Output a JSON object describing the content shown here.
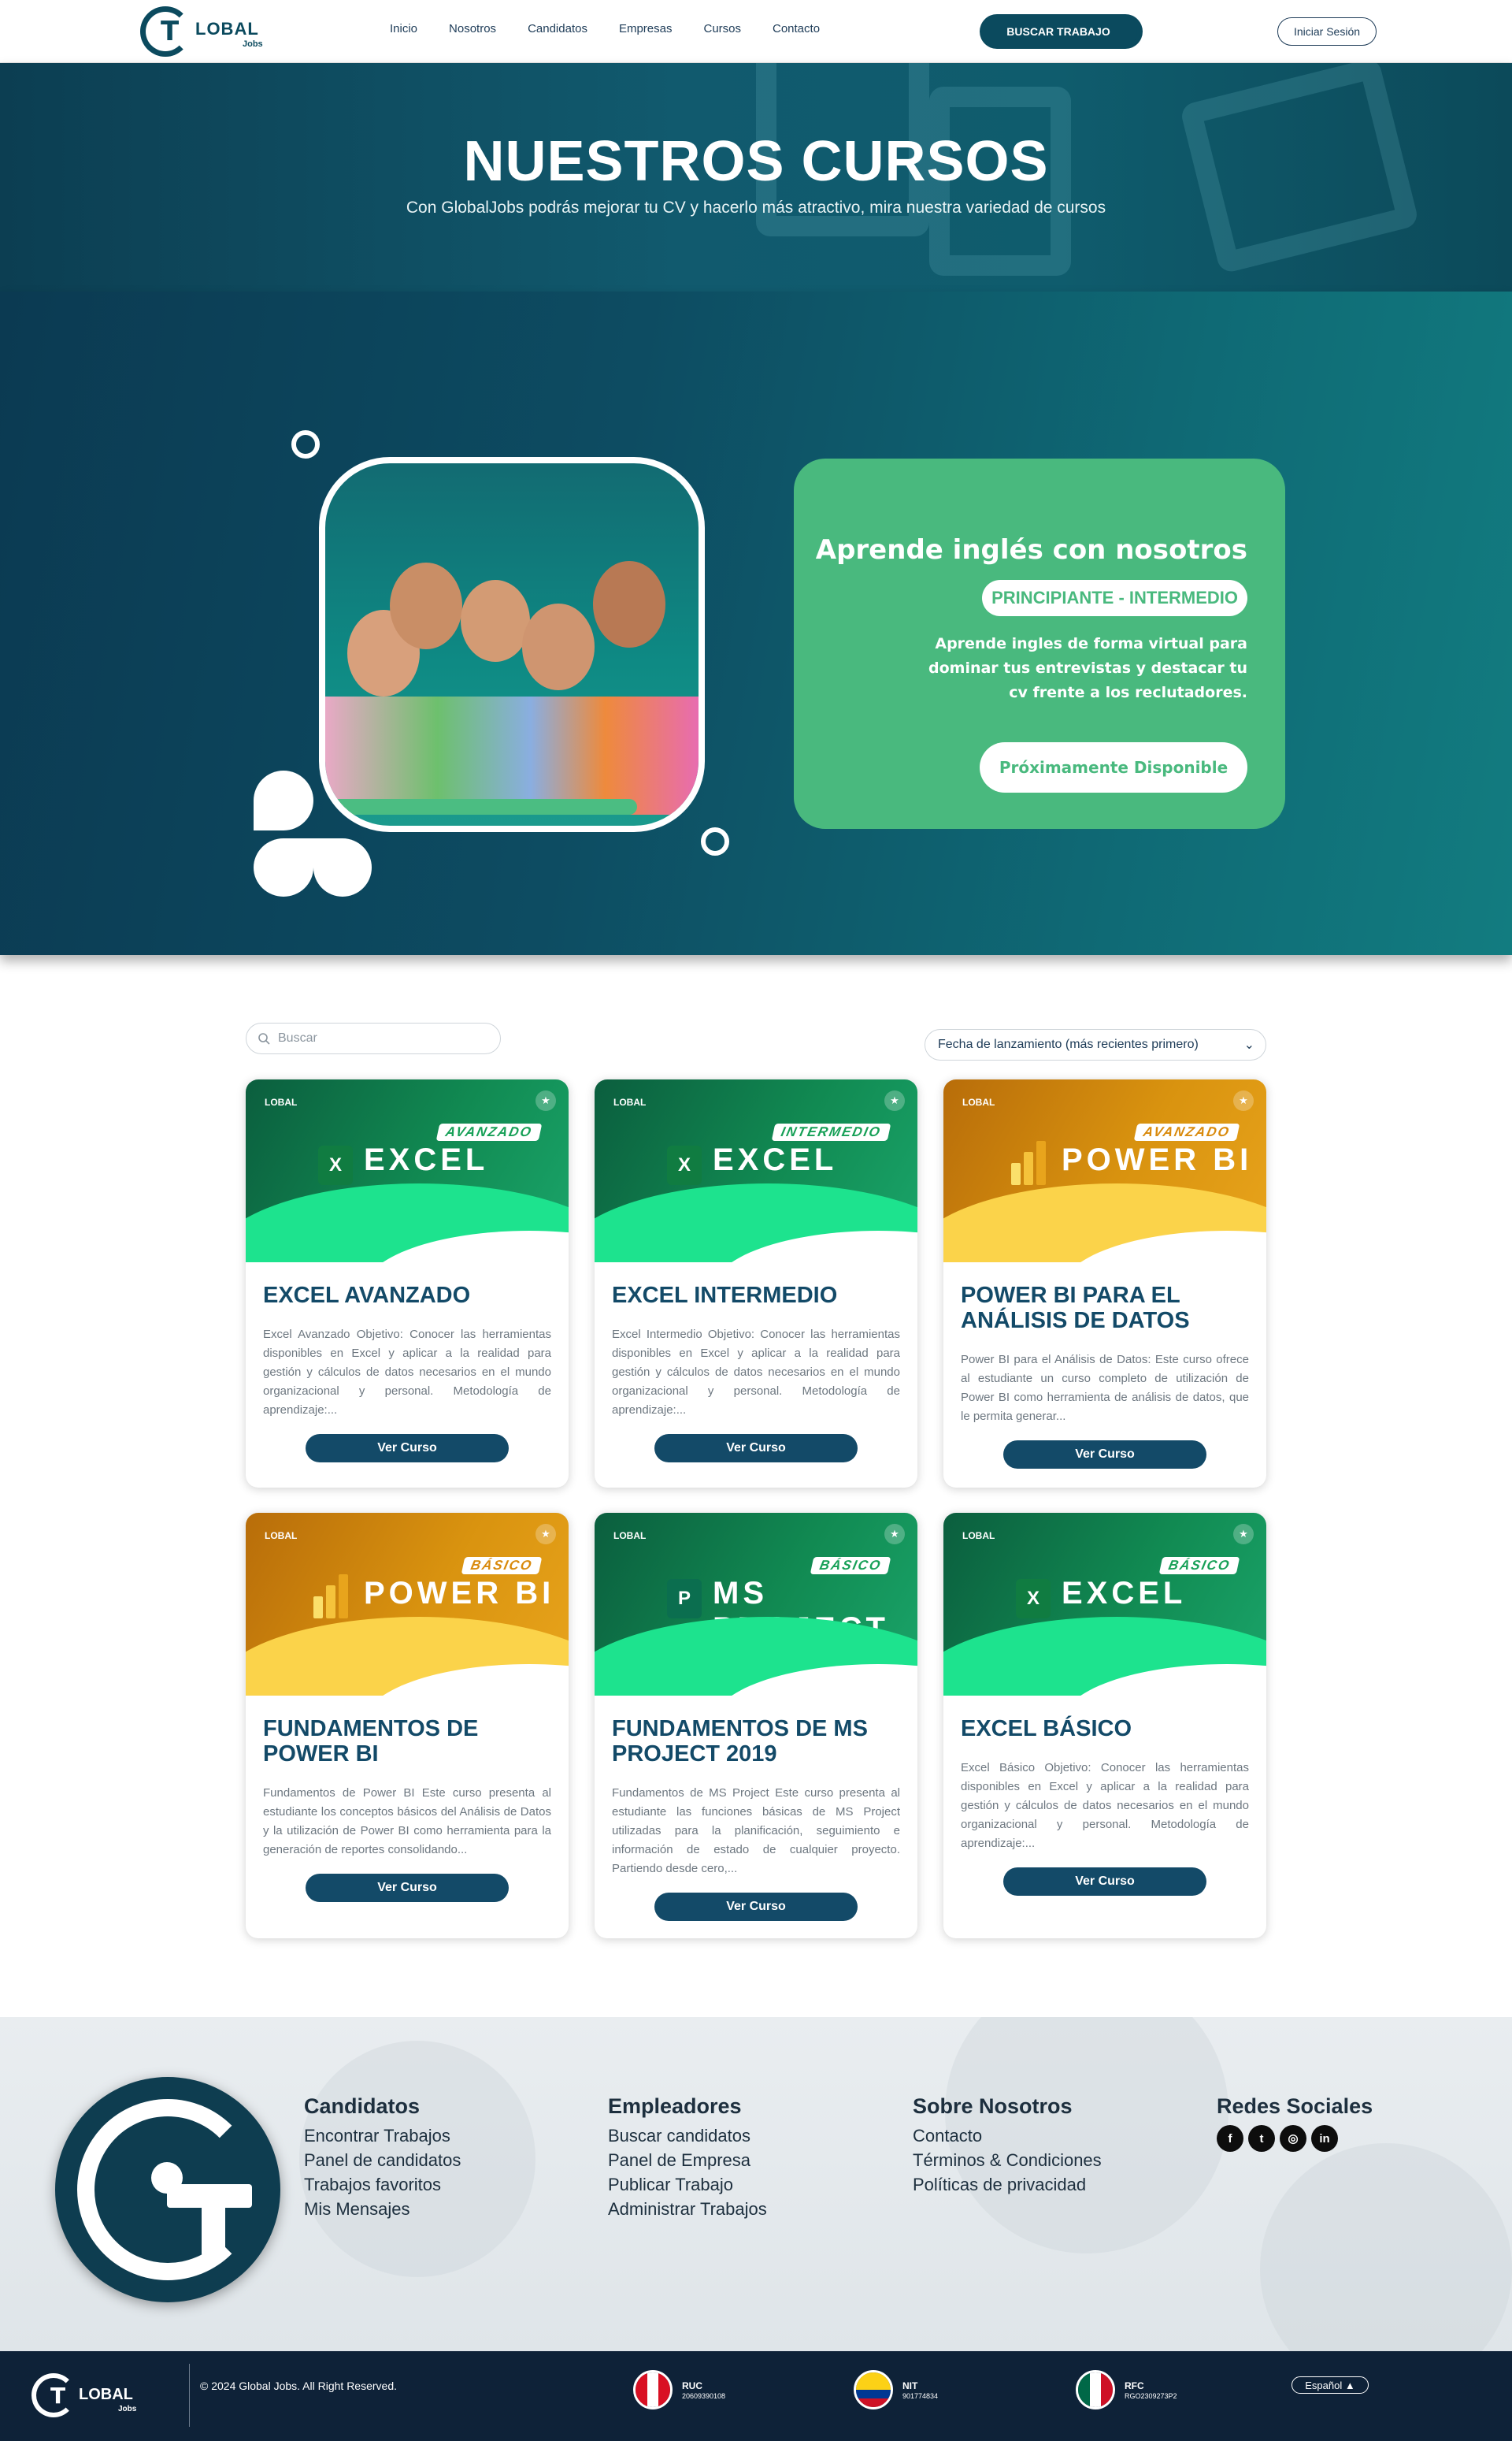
{
  "header": {
    "logo_word": "LOBAL",
    "logo_sub": "Jobs",
    "nav": [
      {
        "label": "Inicio"
      },
      {
        "label": "Nosotros"
      },
      {
        "label": "Candidatos"
      },
      {
        "label": "Empresas"
      },
      {
        "label": "Cursos"
      },
      {
        "label": "Contacto"
      }
    ],
    "cta": "BUSCAR TRABAJO",
    "login": "Iniciar Sesión"
  },
  "banner": {
    "title": "NUESTROS CURSOS",
    "subtitle": "Con GlobalJobs podrás mejorar tu CV y hacerlo más atractivo, mira nuestra variedad de cursos"
  },
  "promo": {
    "title": "Aprende inglés con nosotros",
    "level": "PRINCIPIANTE - INTERMEDIO",
    "description": "Aprende ingles de forma virtual para dominar tus entrevistas y destacar tu cv frente a los reclutadores.",
    "cta": "Próximamente Disponible"
  },
  "filters": {
    "search_placeholder": "Buscar",
    "sort_value": "Fecha de lanzamiento (más recientes primero)"
  },
  "courses": [
    {
      "title": "EXCEL AVANZADO",
      "product": "EXCEL",
      "level": "AVANZADO",
      "app_letter": "X",
      "theme": "green",
      "description": "Excel Avanzado Objetivo: Conocer las herramientas disponibles en Excel y aplicar a la realidad para gestión y cálculos de datos necesarios en el mundo organizacional y personal. Metodología de aprendizaje:...",
      "button": "Ver Curso"
    },
    {
      "title": "EXCEL INTERMEDIO",
      "product": "EXCEL",
      "level": "INTERMEDIO",
      "app_letter": "X",
      "theme": "green",
      "description": "Excel Intermedio Objetivo: Conocer las herramientas disponibles en Excel y aplicar a la realidad para gestión y cálculos de datos necesarios en el mundo organizacional y personal. Metodología de aprendizaje:...",
      "button": "Ver Curso"
    },
    {
      "title": "POWER BI PARA EL ANÁLISIS DE DATOS",
      "product": "POWER BI",
      "level": "AVANZADO",
      "app_letter": "",
      "theme": "gold",
      "description": "Power BI para el Análisis de Datos: Este curso ofrece al estudiante un curso completo de utilización de Power BI como herramienta de análisis de datos, que le permita generar...",
      "button": "Ver Curso"
    },
    {
      "title": "FUNDAMENTOS DE POWER BI",
      "product": "POWER BI",
      "level": "BÁSICO",
      "app_letter": "",
      "theme": "gold",
      "description": "Fundamentos de Power BI Este curso presenta al estudiante los conceptos básicos del Análisis de Datos y la utilización de Power BI como herramienta para la generación de reportes consolidando...",
      "button": "Ver Curso"
    },
    {
      "title": "FUNDAMENTOS DE MS PROJECT 2019",
      "product": "MS PROJECT",
      "level": "BÁSICO",
      "app_letter": "P",
      "theme": "green",
      "description": "Fundamentos de MS Project Este curso presenta al estudiante las funciones básicas de MS Project utilizadas para la planificación, seguimiento e información de estado de cualquier proyecto. Partiendo desde cero,...",
      "button": "Ver Curso"
    },
    {
      "title": "EXCEL BÁSICO",
      "product": "EXCEL",
      "level": "BÁSICO",
      "app_letter": "X",
      "theme": "green",
      "description": "Excel Básico Objetivo: Conocer las herramientas disponibles en Excel y aplicar a la realidad para gestión y cálculos de datos necesarios en el mundo organizacional y personal. Metodología de aprendizaje:...",
      "button": "Ver Curso"
    }
  ],
  "footer": {
    "columns": [
      {
        "title": "Candidatos",
        "links": [
          "Encontrar Trabajos",
          "Panel de candidatos",
          "Trabajos favoritos",
          "Mis Mensajes"
        ]
      },
      {
        "title": "Empleadores",
        "links": [
          "Buscar candidatos",
          "Panel de Empresa",
          "Publicar Trabajo",
          "Administrar Trabajos"
        ]
      },
      {
        "title": "Sobre Nosotros",
        "links": [
          "Contacto",
          "Términos & Condiciones",
          "Políticas de privacidad"
        ]
      }
    ],
    "social_title": "Redes Sociales",
    "social": [
      "facebook-icon",
      "twitter-icon",
      "instagram-icon",
      "linkedin-icon"
    ],
    "copyright": "© 2024 Global Jobs. All Right Reserved.",
    "ids": [
      {
        "label": "RUC",
        "value": "20609390108",
        "country": "peru"
      },
      {
        "label": "NIT",
        "value": "901774834",
        "country": "colombia"
      },
      {
        "label": "RFC",
        "value": "RGO2309273P2",
        "country": "mexico"
      }
    ],
    "language": "Español"
  },
  "colors": {
    "primary": "#0b4a5e",
    "accent_green": "#49b97e",
    "course_title": "#134a68",
    "bottom_bar": "#0e2238"
  }
}
